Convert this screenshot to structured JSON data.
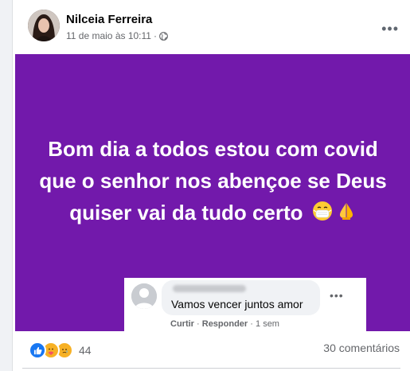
{
  "post": {
    "author": "Nilceia Ferreira",
    "timestamp": "11 de maio às 10:11",
    "separator": "·",
    "privacy_icon": "globe-icon",
    "more_icon": "more-options-icon",
    "banner_color": "#7219ab",
    "banner_text": "Bom dia a todos estou com covid que o senhor nos abençoe se Deus quiser vai da tudo certo",
    "emojis": [
      "face-with-medical-mask-emoji",
      "folded-hands-emoji"
    ]
  },
  "comment": {
    "author_hidden": true,
    "text": "Vamos vencer juntos amor",
    "actions": {
      "like": "Curtir",
      "reply": "Responder",
      "time": "1 sem",
      "sep": "·"
    }
  },
  "footer": {
    "reactions": [
      "like-reaction-icon",
      "care-reaction-icon",
      "sad-reaction-icon"
    ],
    "reaction_count": "44",
    "comments_count": "30 comentários"
  }
}
